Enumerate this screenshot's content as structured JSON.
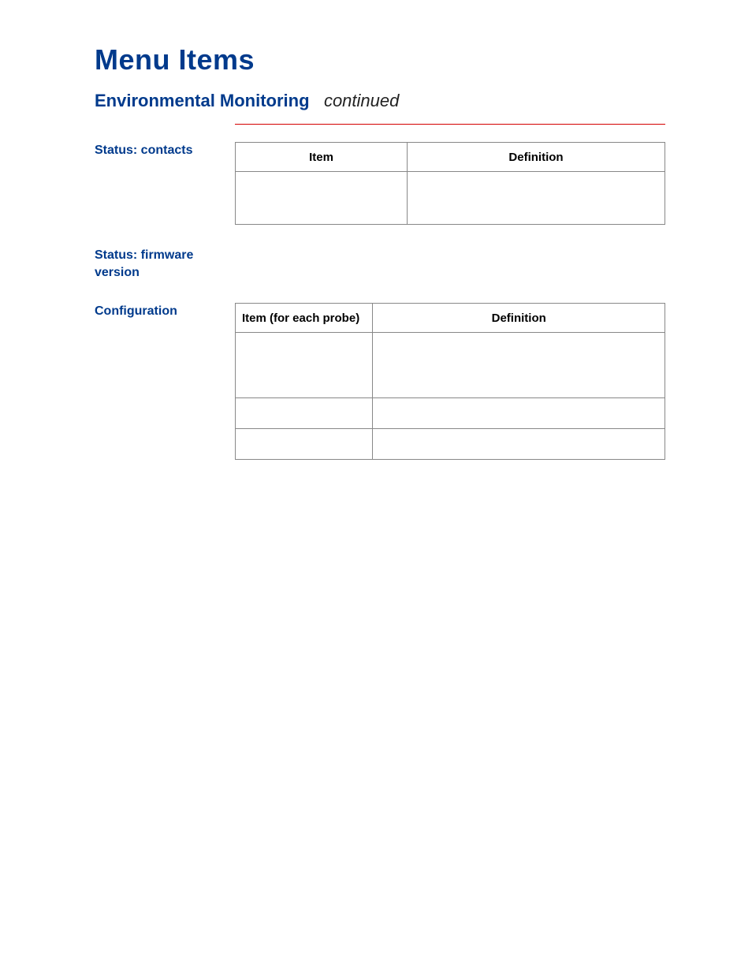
{
  "page_title": "Menu Items",
  "section": {
    "title": "Environmental Monitoring",
    "suffix": "continued"
  },
  "groups": {
    "status_contacts": {
      "label": "Status: contacts",
      "headers": {
        "item": "Item",
        "definition": "Definition"
      },
      "rows": [
        {
          "item": "",
          "definition": ""
        }
      ]
    },
    "status_firmware": {
      "label": "Status: firmware version"
    },
    "configuration": {
      "label": "Configuration",
      "headers": {
        "item": "Item (for each probe)",
        "definition": "Definition"
      },
      "rows": [
        {
          "item": "",
          "definition": ""
        },
        {
          "item": "",
          "definition": ""
        },
        {
          "item": "",
          "definition": ""
        }
      ]
    }
  }
}
